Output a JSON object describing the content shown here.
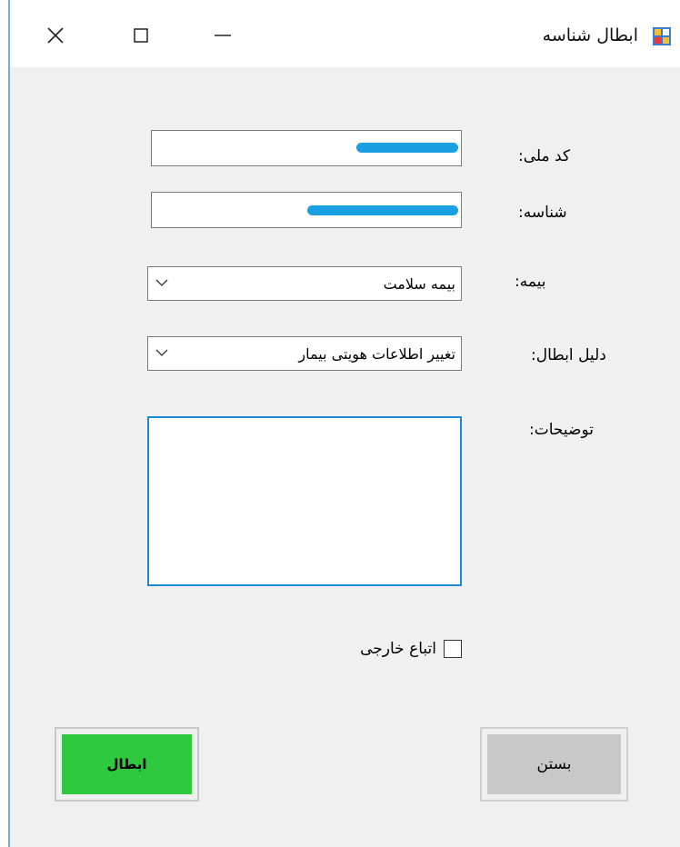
{
  "window": {
    "title": "ابطال شناسه",
    "controls": {
      "close": "close-icon",
      "maximize": "maximize-icon",
      "minimize": "minimize-icon"
    }
  },
  "form": {
    "national_code": {
      "label": "کد ملی:",
      "value": ""
    },
    "identifier": {
      "label": "شناسه:",
      "value": ""
    },
    "insurance": {
      "label": "بیمه:",
      "value": "بیمه سلامت"
    },
    "reason": {
      "label": "دلیل ابطال:",
      "value": "تغییر اطلاعات هویتی بیمار"
    },
    "description": {
      "label": "توضیحات:",
      "value": ""
    },
    "foreign_national": {
      "label": "اتباع خارجی",
      "checked": false
    }
  },
  "buttons": {
    "cancel_id": "ابطال",
    "close": "بستن"
  },
  "colors": {
    "cancel_button": "#2ec83e",
    "close_button": "#c8c8c8",
    "focus_border": "#1e8ad6",
    "redaction": "#1aa0e2"
  }
}
